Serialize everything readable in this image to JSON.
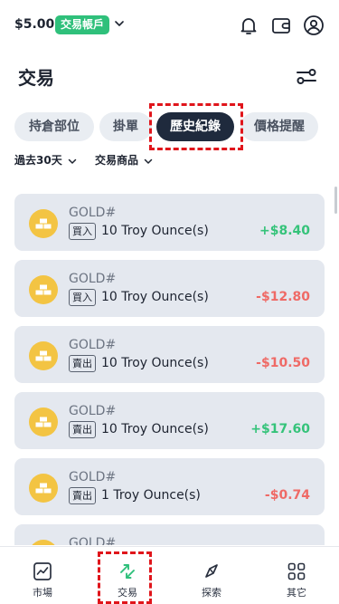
{
  "header": {
    "balance": "$5.00",
    "account_badge": "交易帳戶"
  },
  "page": {
    "title": "交易"
  },
  "tabs": [
    {
      "label": "持倉部位"
    },
    {
      "label": "掛單"
    },
    {
      "label": "歷史紀錄",
      "active": true
    },
    {
      "label": "價格提醒"
    }
  ],
  "filters": {
    "period": "過去30天",
    "product": "交易商品"
  },
  "trades": [
    {
      "symbol": "GOLD#",
      "side": "買入",
      "quantity": "10 Troy Ounce(s)",
      "pnl": "+$8.40",
      "positive": true
    },
    {
      "symbol": "GOLD#",
      "side": "買入",
      "quantity": "10 Troy Ounce(s)",
      "pnl": "-$12.80",
      "positive": false
    },
    {
      "symbol": "GOLD#",
      "side": "賣出",
      "quantity": "10 Troy Ounce(s)",
      "pnl": "-$10.50",
      "positive": false
    },
    {
      "symbol": "GOLD#",
      "side": "賣出",
      "quantity": "10 Troy Ounce(s)",
      "pnl": "+$17.60",
      "positive": true
    },
    {
      "symbol": "GOLD#",
      "side": "賣出",
      "quantity": "1 Troy Ounce(s)",
      "pnl": "-$0.74",
      "positive": false
    },
    {
      "symbol": "GOLD#",
      "side": "",
      "quantity": "",
      "pnl": "",
      "positive": true
    }
  ],
  "bottom_nav": [
    {
      "label": "市場",
      "icon": "market-chart-icon"
    },
    {
      "label": "交易",
      "icon": "trade-arrows-icon",
      "active": true
    },
    {
      "label": "探索",
      "icon": "explore-compass-icon"
    },
    {
      "label": "其它",
      "icon": "more-grid-icon"
    }
  ],
  "colors": {
    "accent_green": "#2fc07b",
    "profit": "#35c37a",
    "loss": "#ef6a66",
    "active_tab": "#1f2a3d",
    "highlight": "#e0151b"
  }
}
